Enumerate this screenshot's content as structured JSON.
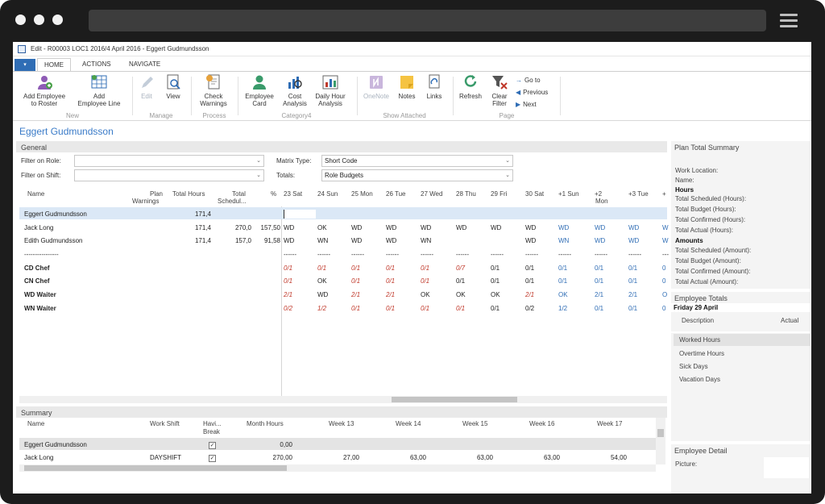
{
  "window": {
    "title": "Edit - R00003 LOC1 2016/4 April  2016 - Eggert Gudmundsson"
  },
  "ribbon": {
    "app_button": "▾",
    "tabs": [
      {
        "label": "HOME"
      },
      {
        "label": "ACTIONS"
      },
      {
        "label": "NAVIGATE"
      }
    ],
    "buttons": {
      "add_employee_roster": {
        "line1": "Add Employee",
        "line2": "to Roster"
      },
      "add_employee_line": {
        "line1": "Add",
        "line2": "Employee Line"
      },
      "edit": {
        "line1": "Edit"
      },
      "view": {
        "line1": "View"
      },
      "check_warnings": {
        "line1": "Check",
        "line2": "Warnings"
      },
      "employee_card": {
        "line1": "Employee",
        "line2": "Card"
      },
      "cost_analysis": {
        "line1": "Cost",
        "line2": "Analysis"
      },
      "daily_hour_analysis": {
        "line1": "Daily Hour",
        "line2": "Analysis"
      },
      "onenote": {
        "line1": "OneNote"
      },
      "notes": {
        "line1": "Notes"
      },
      "links": {
        "line1": "Links"
      },
      "refresh": {
        "line1": "Refresh"
      },
      "clear_filter": {
        "line1": "Clear",
        "line2": "Filter"
      },
      "go_to": "Go to",
      "previous": "Previous",
      "next": "Next"
    },
    "groups": {
      "new": "New",
      "manage": "Manage",
      "process": "Process",
      "category4": "Category4",
      "show_attached": "Show Attached",
      "page": "Page"
    }
  },
  "page_title": "Eggert Gudmundsson",
  "general": {
    "title": "General",
    "filter_role_label": "Filter on Role:",
    "filter_role_value": "",
    "filter_shift_label": "Filter on Shift:",
    "filter_shift_value": "",
    "matrix_type_label": "Matrix Type:",
    "matrix_type_value": "Short Code",
    "totals_label": "Totals:",
    "totals_value": "Role Budgets",
    "columns": {
      "name": "Name",
      "plan_warnings_1": "Plan",
      "plan_warnings_2": "Warnings",
      "total_hours": "Total Hours",
      "total_sched_1": "Total",
      "total_sched_2": "Schedul...",
      "percent": "%",
      "days": [
        "23 Sat",
        "24 Sun",
        "25 Mon",
        "26 Tue",
        "27 Wed",
        "28 Thu",
        "29 Fri",
        "30 Sat",
        "+1 Sun",
        "+2",
        "+3 Tue",
        "+"
      ],
      "day10_second_line": "Mon"
    },
    "rows": [
      {
        "name": "Eggert Gudmundsson",
        "total_hours": "171,4",
        "total_sched": "",
        "percent": "",
        "cells": []
      },
      {
        "name": "Jack Long",
        "total_hours": "171,4",
        "total_sched": "270,0",
        "percent": "157,50",
        "cells": [
          "WD",
          "OK",
          "WD",
          "WD",
          "WD",
          "WD",
          "WD",
          "WD",
          "WD",
          "WD",
          "WD",
          "W"
        ]
      },
      {
        "name": "Edith  Gudmundsson",
        "total_hours": "171,4",
        "total_sched": "157,0",
        "percent": "91,58",
        "cells": [
          "WD",
          "WN",
          "WD",
          "WD",
          "WN",
          "",
          "",
          "WD",
          "WN",
          "WD",
          "WD",
          "W"
        ]
      },
      {
        "name": "----------------",
        "total_hours": "",
        "total_sched": "",
        "percent": "",
        "cells": [
          "------",
          "------",
          "------",
          "------",
          "------",
          "------",
          "------",
          "------",
          "------",
          "------",
          "------",
          "---"
        ]
      },
      {
        "name": "CD Chef",
        "total_hours": "",
        "total_sched": "",
        "percent": "",
        "cells": [
          "0/1",
          "0/1",
          "0/1",
          "0/1",
          "0/1",
          "0/7",
          "0/1",
          "0/1",
          "0/1",
          "0/1",
          "0/1",
          "0"
        ]
      },
      {
        "name": "CN Chef",
        "total_hours": "",
        "total_sched": "",
        "percent": "",
        "cells": [
          "0/1",
          "OK",
          "0/1",
          "0/1",
          "0/1",
          "0/1",
          "0/1",
          "0/1",
          "0/1",
          "0/1",
          "0/1",
          "0"
        ]
      },
      {
        "name": "WD Waiter",
        "total_hours": "",
        "total_sched": "",
        "percent": "",
        "cells": [
          "2/1",
          "WD",
          "2/1",
          "2/1",
          "OK",
          "OK",
          "OK",
          "2/1",
          "OK",
          "2/1",
          "2/1",
          "O"
        ]
      },
      {
        "name": "WN Waiter",
        "total_hours": "",
        "total_sched": "",
        "percent": "",
        "cells": [
          "0/2",
          "1/2",
          "0/1",
          "0/1",
          "0/1",
          "0/1",
          "0/1",
          "0/2",
          "1/2",
          "0/1",
          "0/1",
          "0"
        ]
      }
    ]
  },
  "summary": {
    "title": "Summary",
    "columns": {
      "name": "Name",
      "work_shift": "Work Shift",
      "havi_break_1": "Havi...",
      "havi_break_2": "Break",
      "month_hours": "Month Hours",
      "week13": "Week 13",
      "week14": "Week 14",
      "week15": "Week 15",
      "week16": "Week 16",
      "week17": "Week 17"
    },
    "rows": [
      {
        "name": "Eggert Gudmundsson",
        "work_shift": "",
        "havi_break": true,
        "month_hours": "0,00",
        "week13": "",
        "week14": "",
        "week15": "",
        "week16": "",
        "week17": ""
      },
      {
        "name": "Jack Long",
        "work_shift": "DAYSHIFT",
        "havi_break": true,
        "month_hours": "270,00",
        "week13": "27,00",
        "week14": "63,00",
        "week15": "63,00",
        "week16": "63,00",
        "week17": "54,00"
      }
    ]
  },
  "plan_total_summary": {
    "title": "Plan Total Summary",
    "work_location": "Work Location:",
    "name": "Name:",
    "hours_header": "Hours",
    "hours_items": [
      "Total Scheduled (Hours):",
      "Total Budget (Hours):",
      "Total Confirmed (Hours):",
      "Total Actual (Hours):"
    ],
    "amounts_header": "Amounts",
    "amounts_items": [
      "Total Scheduled (Amount):",
      "Total Budget (Amount):",
      "Total Confirmed (Amount):",
      "Total Actual (Amount):"
    ]
  },
  "employee_totals": {
    "title": "Employee Totals",
    "date": "Friday 29  April",
    "col_description": "Description",
    "col_actual": "Actual",
    "items": [
      "Worked Hours",
      "Overtime Hours",
      "Sick Days",
      "Vacation Days"
    ]
  },
  "employee_detail": {
    "title": "Employee Detail",
    "picture_label": "Picture:"
  },
  "colors": {
    "accent": "#2f6db5",
    "title_blue": "#3a7bc8",
    "warning_red": "#c0392b",
    "selected_row": "#dbe8f6"
  }
}
